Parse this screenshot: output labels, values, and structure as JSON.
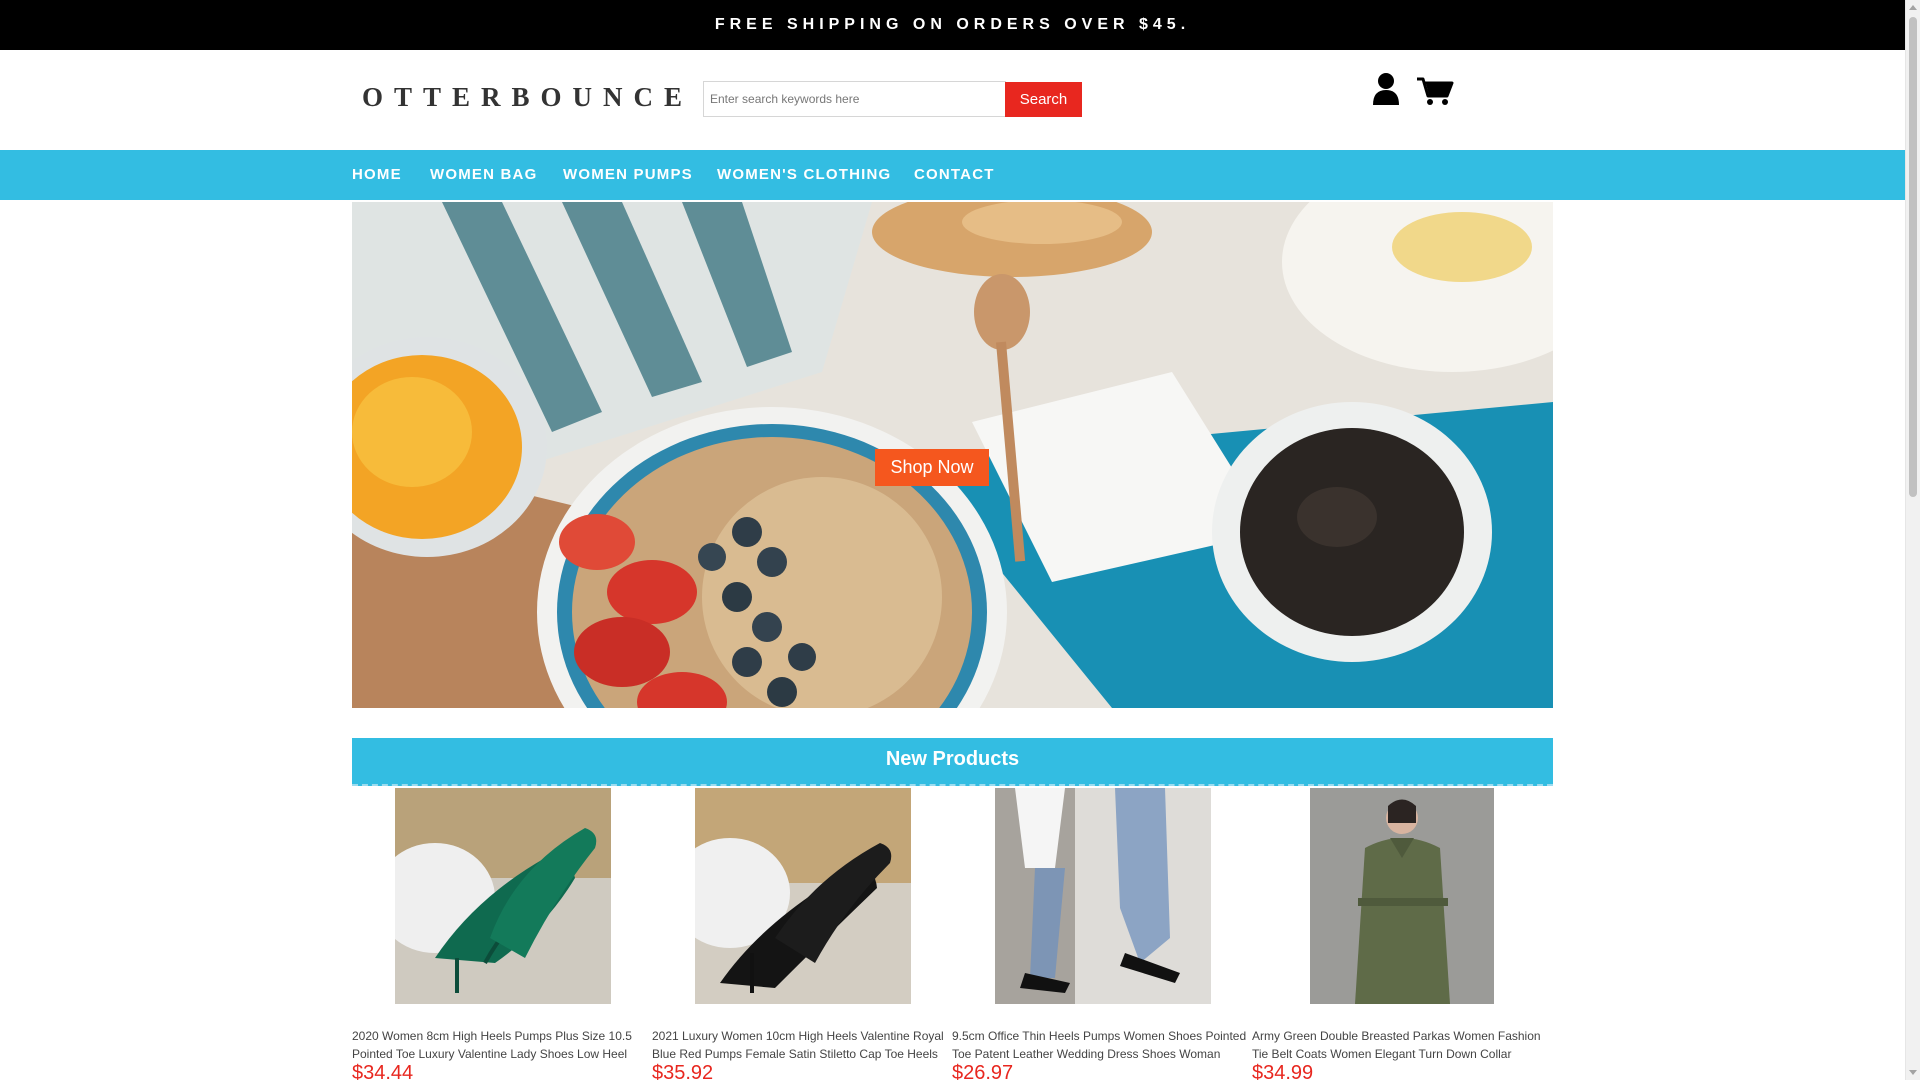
{
  "topbar": {
    "text": "FREE SHIPPING ON ORDERS OVER $45."
  },
  "header": {
    "logo": "OTTERBOUNCE",
    "search": {
      "placeholder": "Enter search keywords here",
      "value": "",
      "button_label": "Search"
    },
    "icons": {
      "user": "user-icon",
      "cart": "cart-icon"
    }
  },
  "nav": {
    "items": [
      {
        "label": "HOME"
      },
      {
        "label": "WOMEN BAG"
      },
      {
        "label": "WOMEN PUMPS"
      },
      {
        "label": "WOMEN'S CLOTHING"
      },
      {
        "label": "CONTACT"
      }
    ]
  },
  "hero": {
    "cta_label": "Shop Now"
  },
  "new_products": {
    "title": "New Products",
    "items": [
      {
        "title": "2020 Women 8cm High Heels Pumps Plus Size 10.5 Pointed Toe Luxury Valentine Lady Shoes Low Heel",
        "price": "$34.44"
      },
      {
        "title": "2021 Luxury Women 10cm High Heels Valentine Royal Blue Red Pumps Female Satin Stiletto Cap Toe Heels",
        "price": "$35.92"
      },
      {
        "title": "9.5cm Office Thin Heels Pumps Women Shoes Pointed Toe Patent Leather Wedding Dress Shoes Woman",
        "price": "$26.97"
      },
      {
        "title": "Army Green Double Breasted Parkas Women Fashion Tie Belt Coats Women Elegant Turn Down Collar",
        "price": "$34.99"
      }
    ]
  },
  "colors": {
    "topbar_bg": "#000000",
    "nav_bg": "#33bde2",
    "search_button": "#e8271f",
    "price": "#e8271f",
    "cta": "#f5571e"
  }
}
